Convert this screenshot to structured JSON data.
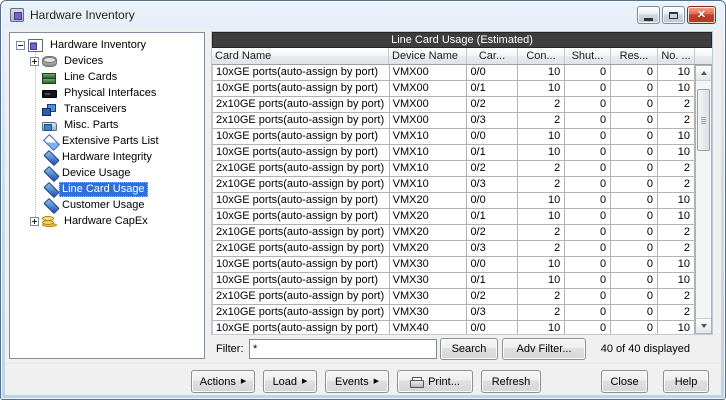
{
  "window": {
    "title": "Hardware Inventory"
  },
  "icons": {
    "close": "✕",
    "menu_arrow": "▶",
    "scroll_up": "▲",
    "scroll_down": "▼"
  },
  "colors": {
    "selection_blue": "#2f6fdc",
    "table_header_dark": "#3e3e3e",
    "titlebar_close_red": "#c6402a"
  },
  "tree": {
    "items": [
      {
        "label": "Hardware Inventory",
        "level": 0,
        "expander": "minus",
        "icon": "report",
        "selected": false
      },
      {
        "label": "Devices",
        "level": 1,
        "expander": "plus",
        "icon": "devices",
        "selected": false
      },
      {
        "label": "Line Cards",
        "level": 1,
        "expander": null,
        "icon": "line-cards",
        "selected": false
      },
      {
        "label": "Physical Interfaces",
        "level": 1,
        "expander": null,
        "icon": "interfaces",
        "selected": false
      },
      {
        "label": "Transceivers",
        "level": 1,
        "expander": null,
        "icon": "transceivers",
        "selected": false
      },
      {
        "label": "Misc. Parts",
        "level": 1,
        "expander": null,
        "icon": "misc-parts",
        "selected": false
      },
      {
        "label": "Extensive Parts List",
        "level": 1,
        "expander": null,
        "icon": "parts-list",
        "selected": false
      },
      {
        "label": "Hardware Integrity",
        "level": 1,
        "expander": null,
        "icon": "diamond",
        "selected": false
      },
      {
        "label": "Device Usage",
        "level": 1,
        "expander": null,
        "icon": "diamond",
        "selected": false
      },
      {
        "label": "Line Card Usage",
        "level": 1,
        "expander": null,
        "icon": "diamond",
        "selected": true
      },
      {
        "label": "Customer Usage",
        "level": 1,
        "expander": null,
        "icon": "diamond",
        "selected": false
      },
      {
        "label": "Hardware CapEx",
        "level": 1,
        "expander": "plus",
        "icon": "coins",
        "selected": false
      }
    ]
  },
  "table": {
    "title": "Line Card Usage (Estimated)",
    "columns": [
      "Card Name",
      "Device Name",
      "Car...",
      "Con...",
      "Shut...",
      "Res...",
      "No. ..."
    ],
    "rows": [
      [
        "10xGE ports(auto-assign by port)",
        "VMX00",
        "0/0",
        "10",
        "0",
        "0",
        "10"
      ],
      [
        "10xGE ports(auto-assign by port)",
        "VMX00",
        "0/1",
        "10",
        "0",
        "0",
        "10"
      ],
      [
        "2x10GE ports(auto-assign by port)",
        "VMX00",
        "0/2",
        "2",
        "0",
        "0",
        "2"
      ],
      [
        "2x10GE ports(auto-assign by port)",
        "VMX00",
        "0/3",
        "2",
        "0",
        "0",
        "2"
      ],
      [
        "10xGE ports(auto-assign by port)",
        "VMX10",
        "0/0",
        "10",
        "0",
        "0",
        "10"
      ],
      [
        "10xGE ports(auto-assign by port)",
        "VMX10",
        "0/1",
        "10",
        "0",
        "0",
        "10"
      ],
      [
        "2x10GE ports(auto-assign by port)",
        "VMX10",
        "0/2",
        "2",
        "0",
        "0",
        "2"
      ],
      [
        "2x10GE ports(auto-assign by port)",
        "VMX10",
        "0/3",
        "2",
        "0",
        "0",
        "2"
      ],
      [
        "10xGE ports(auto-assign by port)",
        "VMX20",
        "0/0",
        "10",
        "0",
        "0",
        "10"
      ],
      [
        "10xGE ports(auto-assign by port)",
        "VMX20",
        "0/1",
        "10",
        "0",
        "0",
        "10"
      ],
      [
        "2x10GE ports(auto-assign by port)",
        "VMX20",
        "0/2",
        "2",
        "0",
        "0",
        "2"
      ],
      [
        "2x10GE ports(auto-assign by port)",
        "VMX20",
        "0/3",
        "2",
        "0",
        "0",
        "2"
      ],
      [
        "10xGE ports(auto-assign by port)",
        "VMX30",
        "0/0",
        "10",
        "0",
        "0",
        "10"
      ],
      [
        "10xGE ports(auto-assign by port)",
        "VMX30",
        "0/1",
        "10",
        "0",
        "0",
        "10"
      ],
      [
        "2x10GE ports(auto-assign by port)",
        "VMX30",
        "0/2",
        "2",
        "0",
        "0",
        "2"
      ],
      [
        "2x10GE ports(auto-assign by port)",
        "VMX30",
        "0/3",
        "2",
        "0",
        "0",
        "2"
      ],
      [
        "10xGE ports(auto-assign by port)",
        "VMX40",
        "0/0",
        "10",
        "0",
        "0",
        "10"
      ]
    ]
  },
  "filter": {
    "label": "Filter:",
    "value": "*",
    "search_label": "Search",
    "adv_filter_label": "Adv Filter...",
    "status": "40 of 40 displayed"
  },
  "footer": {
    "buttons": [
      {
        "label": "Actions",
        "arrow": true
      },
      {
        "label": "Load",
        "arrow": true
      },
      {
        "label": "Events",
        "arrow": true
      },
      {
        "label": "Print...",
        "icon": "printer"
      },
      {
        "label": "Refresh"
      },
      {
        "label": "Close"
      },
      {
        "label": "Help"
      }
    ]
  }
}
